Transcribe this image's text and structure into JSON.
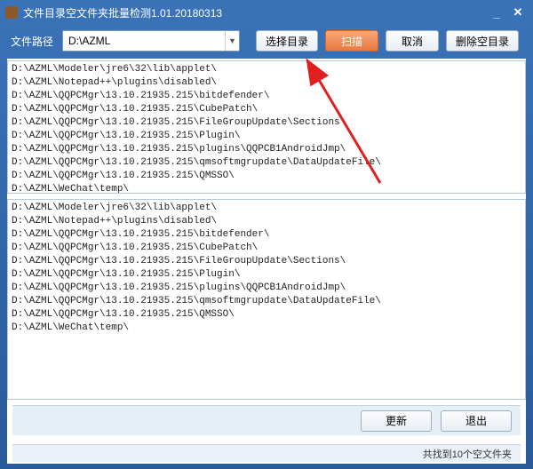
{
  "window": {
    "title": "文件目录空文件夹批量检测1.01.20180313"
  },
  "toolbar": {
    "path_label": "文件路径",
    "path_value": "D:\\AZML",
    "select_dir": "选择目录",
    "scan": "扫描",
    "cancel": "取消",
    "delete_empty": "删除空目录"
  },
  "top_list": [
    "D:\\AZML\\Modeler\\jre6\\32\\lib\\applet\\",
    "D:\\AZML\\Notepad++\\plugins\\disabled\\",
    "D:\\AZML\\QQPCMgr\\13.10.21935.215\\bitdefender\\",
    "D:\\AZML\\QQPCMgr\\13.10.21935.215\\CubePatch\\",
    "D:\\AZML\\QQPCMgr\\13.10.21935.215\\FileGroupUpdate\\Sections\\",
    "D:\\AZML\\QQPCMgr\\13.10.21935.215\\Plugin\\",
    "D:\\AZML\\QQPCMgr\\13.10.21935.215\\plugins\\QQPCB1AndroidJmp\\",
    "D:\\AZML\\QQPCMgr\\13.10.21935.215\\qmsoftmgrupdate\\DataUpdateFile\\",
    "D:\\AZML\\QQPCMgr\\13.10.21935.215\\QMSSO\\",
    "D:\\AZML\\WeChat\\temp\\"
  ],
  "bottom_list": [
    "D:\\AZML\\Modeler\\jre6\\32\\lib\\applet\\",
    "D:\\AZML\\Notepad++\\plugins\\disabled\\",
    "D:\\AZML\\QQPCMgr\\13.10.21935.215\\bitdefender\\",
    "D:\\AZML\\QQPCMgr\\13.10.21935.215\\CubePatch\\",
    "D:\\AZML\\QQPCMgr\\13.10.21935.215\\FileGroupUpdate\\Sections\\",
    "D:\\AZML\\QQPCMgr\\13.10.21935.215\\Plugin\\",
    "D:\\AZML\\QQPCMgr\\13.10.21935.215\\plugins\\QQPCB1AndroidJmp\\",
    "D:\\AZML\\QQPCMgr\\13.10.21935.215\\qmsoftmgrupdate\\DataUpdateFile\\",
    "D:\\AZML\\QQPCMgr\\13.10.21935.215\\QMSSO\\",
    "D:\\AZML\\WeChat\\temp\\"
  ],
  "footer": {
    "update": "更新",
    "exit": "退出"
  },
  "status": {
    "text": "共找到10个空文件夹"
  },
  "annotation": {
    "arrow_target": "scan-button"
  }
}
